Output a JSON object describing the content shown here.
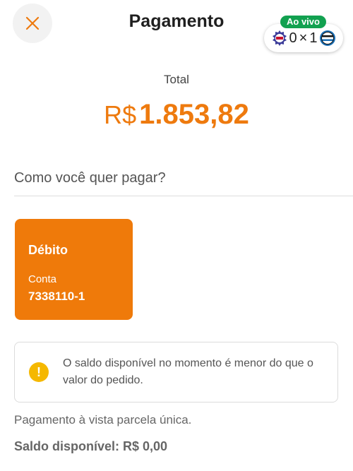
{
  "header": {
    "title": "Pagamento",
    "close_icon": "close-icon",
    "accent_color": "#ee7a0e"
  },
  "live_match": {
    "badge": "Ao vivo",
    "home_team_icon": "team-crest-icon",
    "home_score": "0",
    "separator": "×",
    "away_score": "1",
    "away_team_icon": "team-crest-icon"
  },
  "total": {
    "label": "Total",
    "currency": "R$",
    "amount": "1.853,82"
  },
  "payment": {
    "question": "Como você quer pagar?",
    "method": {
      "name": "Débito",
      "account_label": "Conta",
      "account_number": "7338110-1",
      "color": "#ef7a0a"
    }
  },
  "notice": {
    "icon": "warning-icon",
    "text": "O saldo disponível no momento é menor do que o valor do pedido."
  },
  "footer": {
    "installment_text": "Pagamento à vista parcela única.",
    "balance_text": "Saldo disponível: R$ 0,00"
  }
}
